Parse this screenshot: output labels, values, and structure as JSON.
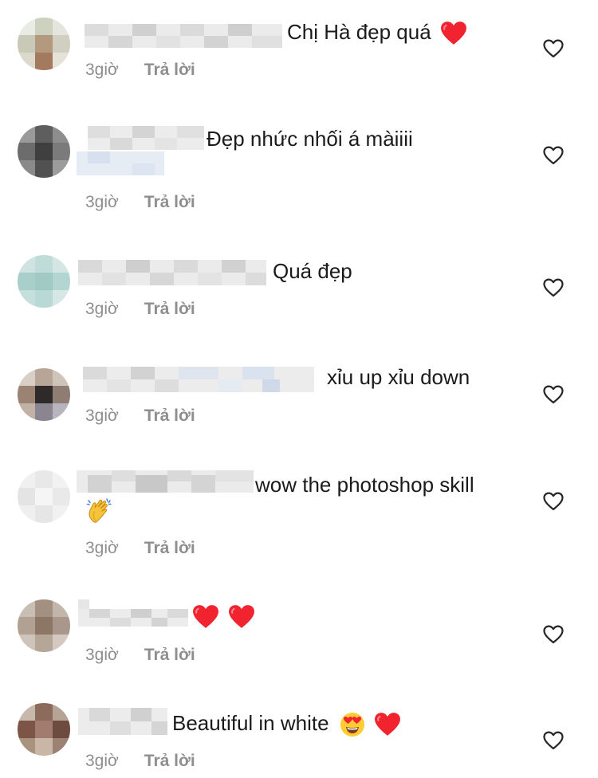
{
  "colors": {
    "text": "#1b1b1b",
    "meta": "#8e8e8e",
    "heart_red": "#f0232f",
    "icon_stroke": "#262626"
  },
  "comments": [
    {
      "username_redacted": true,
      "text": "Chị Hà đẹp quá",
      "emoji_after": [
        "red-heart"
      ],
      "time": "3giờ",
      "reply_label": "Trả lời",
      "liked": false
    },
    {
      "username_redacted": true,
      "text": "Đẹp nhức nhối á màiiii",
      "emoji_after": [],
      "time": "3giờ",
      "reply_label": "Trả lời",
      "liked": false
    },
    {
      "username_redacted": true,
      "text": "Quá đẹp",
      "emoji_after": [],
      "time": "3giờ",
      "reply_label": "Trả lời",
      "liked": false
    },
    {
      "username_redacted": true,
      "text": "xỉu up xỉu down",
      "emoji_after": [],
      "time": "3giờ",
      "reply_label": "Trả lời",
      "liked": false
    },
    {
      "username_redacted": true,
      "text": "wow the photoshop skill",
      "emoji_after": [
        "clapping-hands"
      ],
      "time": "3giờ",
      "reply_label": "Trả lời",
      "liked": false
    },
    {
      "username_redacted": true,
      "text": "",
      "emoji_after": [
        "red-heart",
        "red-heart"
      ],
      "time": "3giờ",
      "reply_label": "Trả lời",
      "liked": false
    },
    {
      "username_redacted": true,
      "text": "Beautiful in white",
      "emoji_after": [
        "heart-eyes-face",
        "red-heart"
      ],
      "time": "3giờ",
      "reply_label": "Trả lời",
      "liked": false
    }
  ],
  "icons": {
    "like": "heart-outline-icon"
  }
}
